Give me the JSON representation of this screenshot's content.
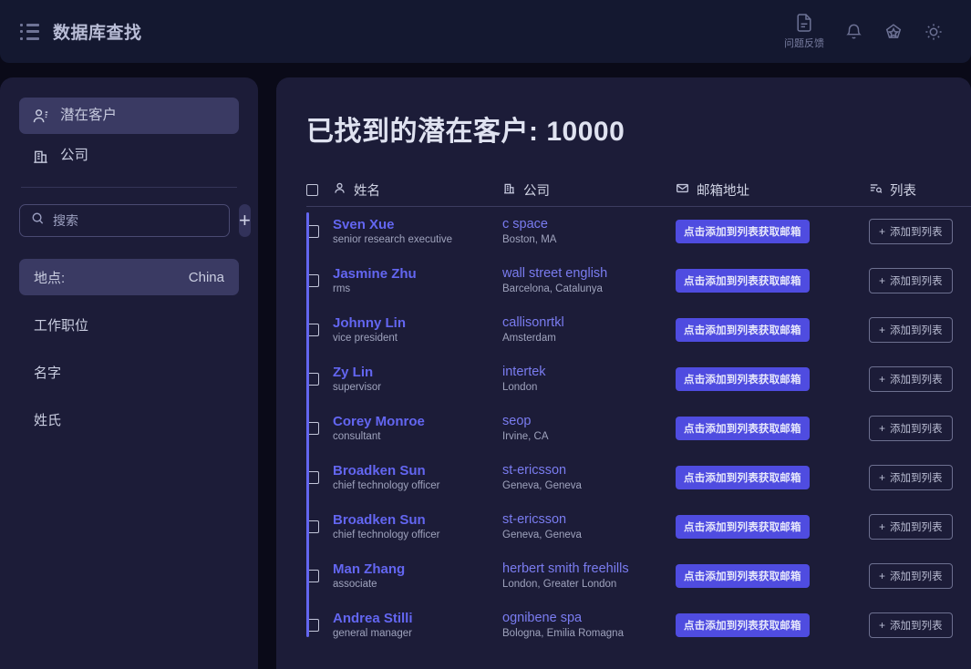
{
  "header": {
    "menu_icon": "list-menu-icon",
    "title": "数据库查找",
    "actions": [
      {
        "icon": "document-feedback-icon",
        "label": "问题反馈"
      },
      {
        "icon": "bell-notification-icon",
        "label": ""
      },
      {
        "icon": "pentagon-badge-icon",
        "label": ""
      },
      {
        "icon": "sun-theme-icon",
        "label": ""
      }
    ]
  },
  "sidebar": {
    "nav": [
      {
        "icon": "person-lead-icon",
        "label": "潜在客户",
        "active": true
      },
      {
        "icon": "building-company-icon",
        "label": "公司",
        "active": false
      }
    ],
    "search": {
      "icon": "search-icon",
      "placeholder": "搜索",
      "value": "",
      "add_label": "+"
    },
    "filters": [
      {
        "label": "地点:",
        "value": "China",
        "active": true
      },
      {
        "label": "工作职位",
        "value": "",
        "active": false
      },
      {
        "label": "名字",
        "value": "",
        "active": false
      },
      {
        "label": "姓氏",
        "value": "",
        "active": false
      }
    ]
  },
  "main": {
    "title": "已找到的潜在客户: 10000",
    "columns": [
      {
        "icon": "person-icon",
        "label": "姓名"
      },
      {
        "icon": "building-icon",
        "label": "公司"
      },
      {
        "icon": "envelope-icon",
        "label": "邮箱地址"
      },
      {
        "icon": "list-icon",
        "label": "列表"
      }
    ],
    "email_button_label": "点击添加到列表获取邮箱",
    "list_button_label": "添加到列表",
    "list_button_plus": "+",
    "rows": [
      {
        "name": "Sven Xue",
        "title": "senior research executive",
        "company": "c space",
        "location": "Boston, MA"
      },
      {
        "name": "Jasmine Zhu",
        "title": "rms",
        "company": "wall street english",
        "location": "Barcelona, Catalunya"
      },
      {
        "name": "Johnny Lin",
        "title": "vice president",
        "company": "callisonrtkl",
        "location": "Amsterdam"
      },
      {
        "name": "Zy Lin",
        "title": "supervisor",
        "company": "intertek",
        "location": "London"
      },
      {
        "name": "Corey Monroe",
        "title": "consultant",
        "company": "seop",
        "location": "Irvine, CA"
      },
      {
        "name": "Broadken Sun",
        "title": "chief technology officer",
        "company": "st-ericsson",
        "location": "Geneva, Geneva"
      },
      {
        "name": "Broadken Sun",
        "title": "chief technology officer",
        "company": "st-ericsson",
        "location": "Geneva, Geneva"
      },
      {
        "name": "Man Zhang",
        "title": "associate",
        "company": "herbert smith freehills",
        "location": "London, Greater London"
      },
      {
        "name": "Andrea Stilli",
        "title": "general manager",
        "company": "ognibene spa",
        "location": "Bologna, Emilia Romagna"
      }
    ]
  },
  "colors": {
    "page_bg": "#0a0a18",
    "panel_bg": "#1c1c38",
    "topbar_bg": "#141830",
    "accent": "#6366f1",
    "accent_button": "#4f4ce0",
    "active_item": "#3a3a63",
    "text_primary": "#dfe2f0",
    "text_muted": "#9fa3bd"
  }
}
